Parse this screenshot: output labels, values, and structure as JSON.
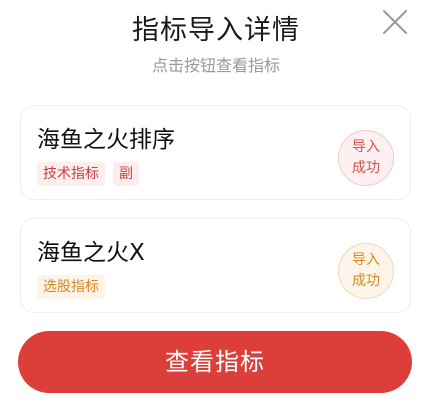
{
  "dialog": {
    "title": "指标导入详情",
    "subtitle": "点击按钮查看指标"
  },
  "cards": [
    {
      "name": "海鱼之火排序",
      "tags": [
        "技术指标",
        "副"
      ],
      "status_line1": "导入",
      "status_line2": "成功",
      "color": "#d0544d"
    },
    {
      "name": "海鱼之火X",
      "tags": [
        "选股指标"
      ],
      "status_line1": "导入",
      "status_line2": "成功",
      "color": "#d98a1f"
    }
  ],
  "footer": {
    "view_button_label": "查看指标",
    "button_color": "#dc3f3a"
  },
  "icons": {
    "close": "close-icon"
  }
}
